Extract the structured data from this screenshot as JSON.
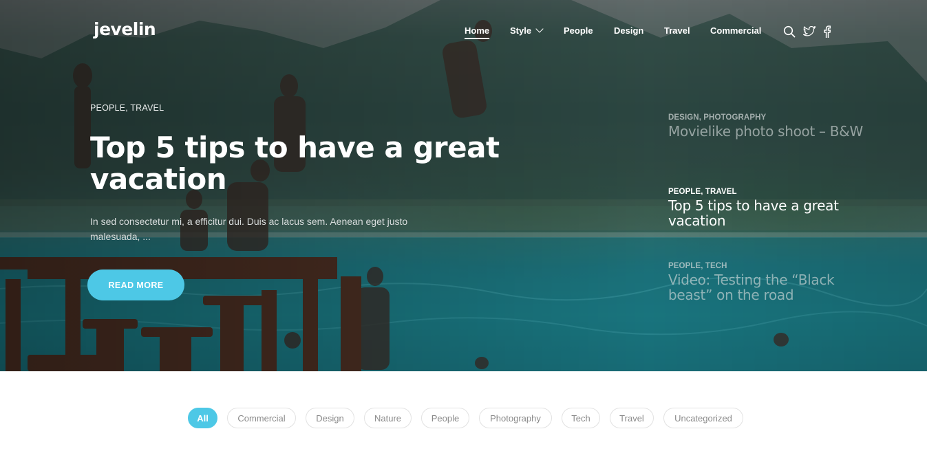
{
  "brand": {
    "logo": "jevelin"
  },
  "nav": {
    "items": [
      {
        "label": "Home"
      },
      {
        "label": "Style"
      },
      {
        "label": "People"
      },
      {
        "label": "Design"
      },
      {
        "label": "Travel"
      },
      {
        "label": "Commercial"
      }
    ],
    "active_index": 0,
    "icons": [
      "search-icon",
      "twitter-icon",
      "facebook-icon"
    ]
  },
  "hero": {
    "categories": "PEOPLE, TRAVEL",
    "title": "Top 5 tips to have a great vacation",
    "excerpt": "In sed consectetur mi, a efficitur dui. Duis ac lacus sem. Aenean eget justo malesuada, ...",
    "button_label": "READ MORE"
  },
  "side_posts": [
    {
      "categories": "DESIGN, PHOTOGRAPHY",
      "title": "Movielike photo shoot – B&W",
      "active": false
    },
    {
      "categories": "PEOPLE, TRAVEL",
      "title": "Top 5 tips to have a great vacation",
      "active": true
    },
    {
      "categories": "PEOPLE, TECH",
      "title": "Video: Testing the “Black beast” on the road",
      "active": false
    }
  ],
  "filters": {
    "items": [
      "All",
      "Commercial",
      "Design",
      "Nature",
      "People",
      "Photography",
      "Tech",
      "Travel",
      "Uncategorized"
    ],
    "active_index": 0
  },
  "colors": {
    "accent": "#4dc8e6",
    "chip_border": "#e2e2e2",
    "chip_text": "#8a8a8a"
  }
}
